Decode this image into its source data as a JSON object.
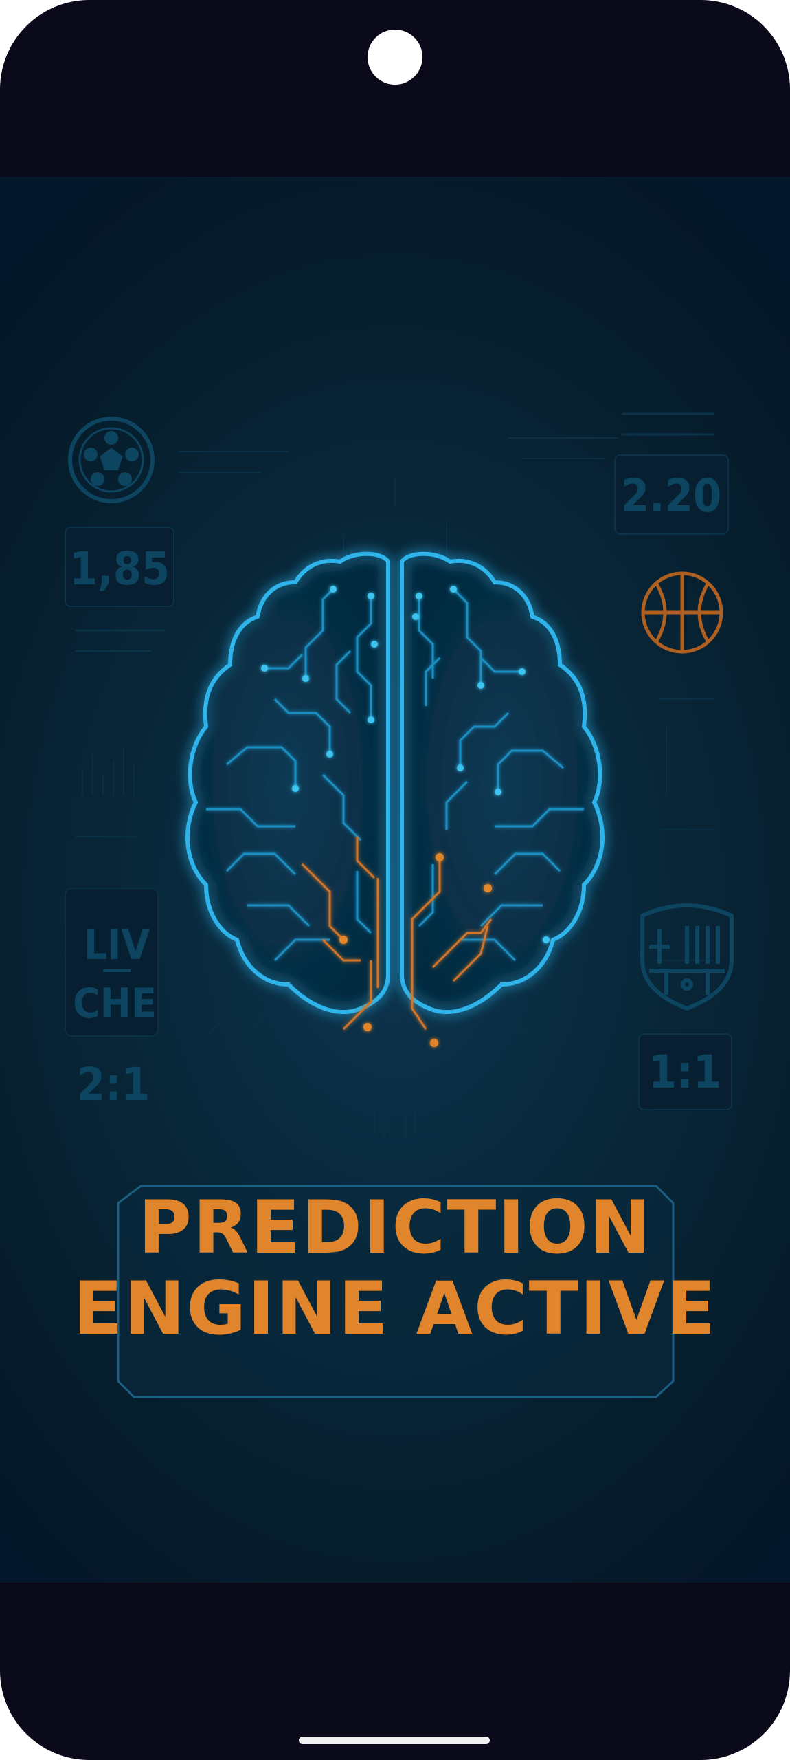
{
  "banner": {
    "line1": "PREDICTION",
    "line2": "ENGINE ACTIVE"
  },
  "stats": {
    "odds_left": "1,85",
    "odds_right": "2.20",
    "team_home": "LIV",
    "team_away": "CHE",
    "score_left": "2:1",
    "score_right": "1:1"
  },
  "icons": {
    "soccer": "soccer-ball-icon",
    "basketball": "basketball-icon",
    "club_crest": "club-crest-icon",
    "brain": "circuit-brain-icon"
  },
  "colors": {
    "frame": "#0a0a1a",
    "screen_bg": "#082739",
    "brain_glow": "#2fb4ea",
    "accent_orange": "#e0852c",
    "faded_stat": "#0d4460"
  }
}
